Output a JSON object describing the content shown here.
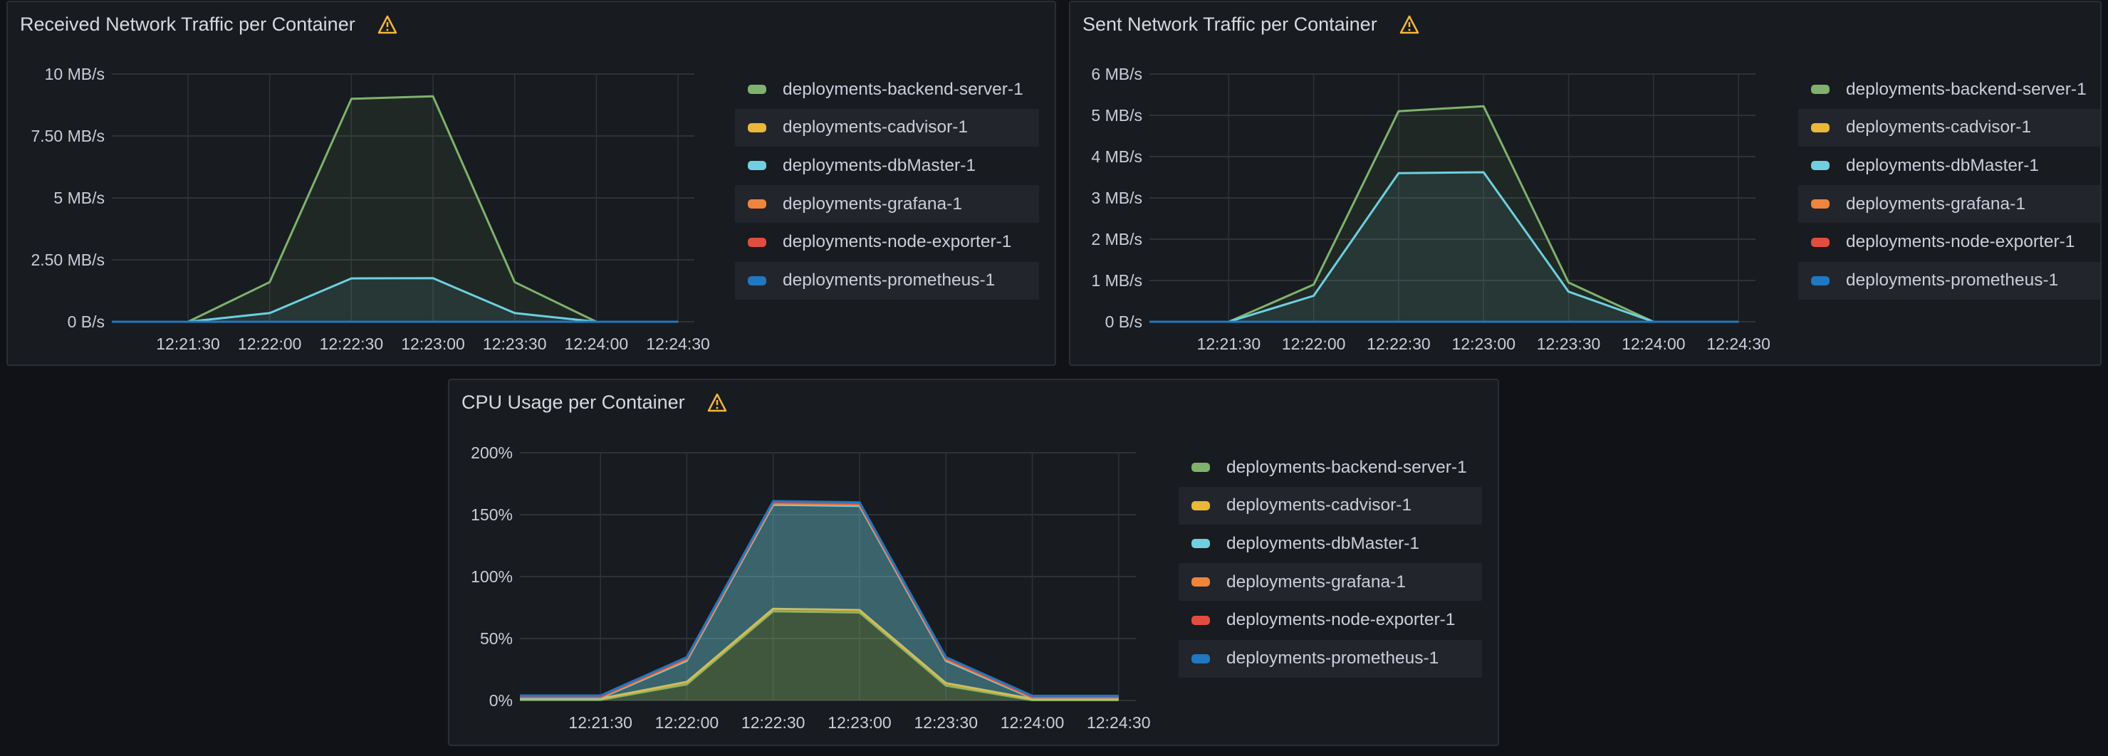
{
  "legend_series": [
    {
      "name": "deployments-backend-server-1",
      "color": "#7eb26d"
    },
    {
      "name": "deployments-cadvisor-1",
      "color": "#eab839"
    },
    {
      "name": "deployments-dbMaster-1",
      "color": "#6ed0e0"
    },
    {
      "name": "deployments-grafana-1",
      "color": "#ef843c"
    },
    {
      "name": "deployments-node-exporter-1",
      "color": "#e24d42"
    },
    {
      "name": "deployments-prometheus-1",
      "color": "#1f78c1"
    }
  ],
  "warning_icon": "warning-triangle-icon",
  "warning_color": "#f5b73d",
  "chart_data": [
    {
      "title": "Received Network Traffic per Container",
      "type": "area",
      "stacked": false,
      "x": [
        "12:21:02",
        "12:21:30",
        "12:22:00",
        "12:22:30",
        "12:23:00",
        "12:23:30",
        "12:24:00",
        "12:24:30"
      ],
      "xlim": [
        "12:21:02",
        "12:24:36"
      ],
      "xticks": [
        "12:21:30",
        "12:22:00",
        "12:22:30",
        "12:23:00",
        "12:23:30",
        "12:24:00",
        "12:24:30"
      ],
      "yunit": "MB/s",
      "ylim": [
        0,
        10
      ],
      "yticks": [
        0,
        2.5,
        5,
        7.5,
        10
      ],
      "ytick_labels": [
        "0 B/s",
        "2.50 MB/s",
        "5 MB/s",
        "7.50 MB/s",
        "10 MB/s"
      ],
      "grid": true,
      "legend": "right",
      "series": [
        {
          "name": "deployments-backend-server-1",
          "values": [
            0,
            0,
            1.6,
            9.0,
            9.1,
            1.6,
            0,
            0
          ]
        },
        {
          "name": "deployments-cadvisor-1",
          "values": [
            0,
            0,
            0,
            0,
            0,
            0,
            0,
            0
          ]
        },
        {
          "name": "deployments-dbMaster-1",
          "values": [
            0,
            0,
            0.35,
            1.75,
            1.76,
            0.35,
            0,
            0
          ]
        },
        {
          "name": "deployments-grafana-1",
          "values": [
            0,
            0,
            0,
            0,
            0,
            0,
            0,
            0
          ]
        },
        {
          "name": "deployments-node-exporter-1",
          "values": [
            0,
            0,
            0,
            0,
            0,
            0,
            0,
            0
          ]
        },
        {
          "name": "deployments-prometheus-1",
          "values": [
            0,
            0,
            0,
            0,
            0,
            0,
            0,
            0
          ]
        }
      ]
    },
    {
      "title": "Sent Network Traffic per Container",
      "type": "area",
      "stacked": false,
      "x": [
        "12:21:02",
        "12:21:30",
        "12:22:00",
        "12:22:30",
        "12:23:00",
        "12:23:30",
        "12:24:00",
        "12:24:30"
      ],
      "xlim": [
        "12:21:02",
        "12:24:36"
      ],
      "xticks": [
        "12:21:30",
        "12:22:00",
        "12:22:30",
        "12:23:00",
        "12:23:30",
        "12:24:00",
        "12:24:30"
      ],
      "yunit": "MB/s",
      "ylim": [
        0,
        6
      ],
      "yticks": [
        0,
        1,
        2,
        3,
        4,
        5,
        6
      ],
      "ytick_labels": [
        "0 B/s",
        "1 MB/s",
        "2 MB/s",
        "3 MB/s",
        "4 MB/s",
        "5 MB/s",
        "6 MB/s"
      ],
      "grid": true,
      "legend": "right",
      "series": [
        {
          "name": "deployments-backend-server-1",
          "values": [
            0,
            0,
            0.9,
            5.1,
            5.22,
            0.95,
            0,
            0
          ]
        },
        {
          "name": "deployments-cadvisor-1",
          "values": [
            0,
            0,
            0,
            0,
            0,
            0,
            0,
            0
          ]
        },
        {
          "name": "deployments-dbMaster-1",
          "values": [
            0,
            0,
            0.63,
            3.6,
            3.62,
            0.73,
            0,
            0
          ]
        },
        {
          "name": "deployments-grafana-1",
          "values": [
            0,
            0,
            0,
            0,
            0,
            0,
            0,
            0
          ]
        },
        {
          "name": "deployments-node-exporter-1",
          "values": [
            0,
            0,
            0,
            0,
            0,
            0,
            0,
            0
          ]
        },
        {
          "name": "deployments-prometheus-1",
          "values": [
            0,
            0,
            0,
            0,
            0,
            0,
            0,
            0
          ]
        }
      ]
    },
    {
      "title": "CPU Usage per Container",
      "type": "area",
      "stacked": true,
      "x": [
        "12:21:02",
        "12:21:30",
        "12:22:00",
        "12:22:30",
        "12:23:00",
        "12:23:30",
        "12:24:00",
        "12:24:30"
      ],
      "xlim": [
        "12:21:02",
        "12:24:36"
      ],
      "xticks": [
        "12:21:30",
        "12:22:00",
        "12:22:30",
        "12:23:00",
        "12:23:30",
        "12:24:00",
        "12:24:30"
      ],
      "yunit": "%",
      "ylim": [
        0,
        200
      ],
      "yticks": [
        0,
        50,
        100,
        150,
        200
      ],
      "ytick_labels": [
        "0%",
        "50%",
        "100%",
        "150%",
        "200%"
      ],
      "grid": true,
      "legend": "right",
      "series": [
        {
          "name": "deployments-backend-server-1",
          "values": [
            0.5,
            0.5,
            13,
            72,
            71,
            12,
            0.3,
            0.3
          ]
        },
        {
          "name": "deployments-cadvisor-1",
          "values": [
            1,
            1,
            2,
            2,
            2,
            2,
            1,
            1
          ]
        },
        {
          "name": "deployments-dbMaster-1",
          "values": [
            0.5,
            0.5,
            17,
            84,
            84,
            18,
            0.5,
            0.5
          ]
        },
        {
          "name": "deployments-grafana-1",
          "values": [
            0.5,
            0.5,
            1,
            1,
            1,
            1,
            0.5,
            0.5
          ]
        },
        {
          "name": "deployments-node-exporter-1",
          "values": [
            0.5,
            0.5,
            1,
            1,
            1,
            1,
            0.5,
            0.5
          ]
        },
        {
          "name": "deployments-prometheus-1",
          "values": [
            1,
            1,
            1,
            1,
            1,
            1,
            1,
            1
          ]
        }
      ]
    }
  ]
}
